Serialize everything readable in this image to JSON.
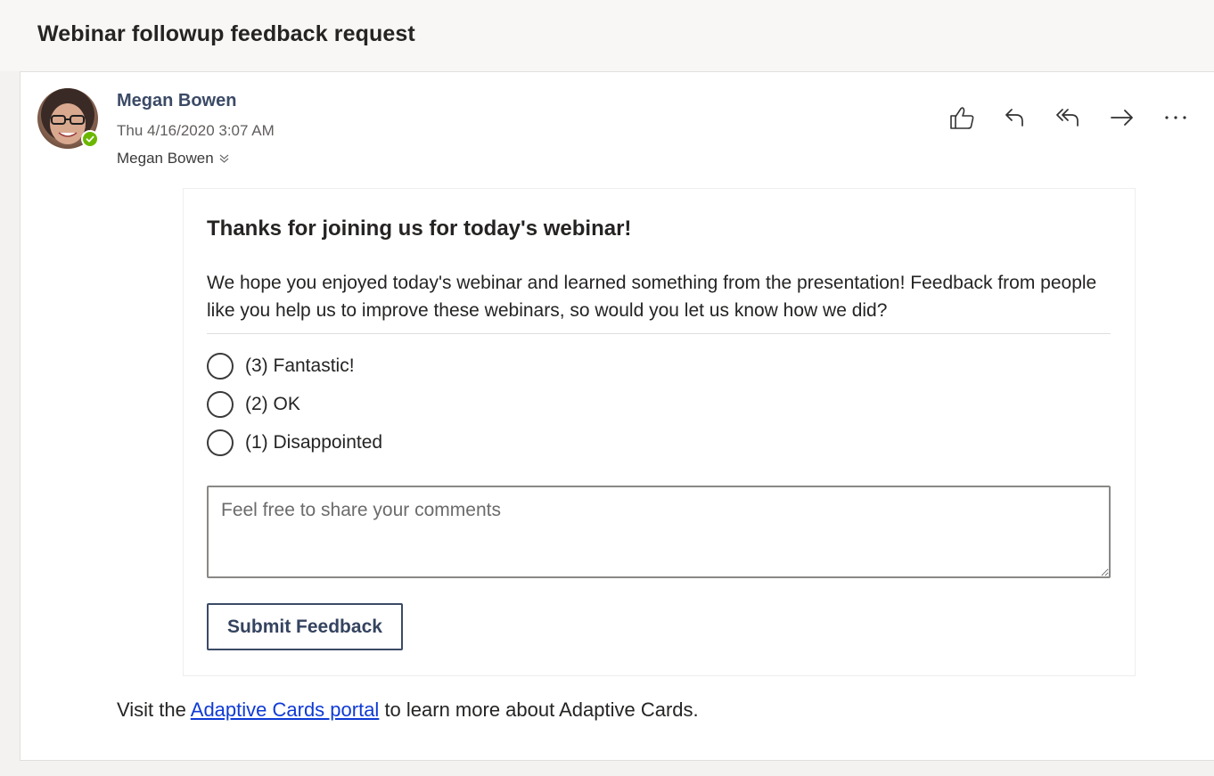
{
  "message": {
    "subject": "Webinar followup feedback request",
    "sender_name": "Megan Bowen",
    "sent_date": "Thu 4/16/2020 3:07 AM",
    "to": "Megan Bowen",
    "presence_color": "#6bb700",
    "actions": [
      {
        "label": "Like",
        "icon": "thumbs-up-icon"
      },
      {
        "label": "Reply",
        "icon": "reply-icon"
      },
      {
        "label": "Reply all",
        "icon": "reply-all-icon"
      },
      {
        "label": "Forward",
        "icon": "forward-icon"
      },
      {
        "label": "More actions",
        "icon": "more-icon"
      }
    ]
  },
  "card": {
    "title": "Thanks for joining us for today's webinar!",
    "body": "We hope you enjoyed today's webinar and learned something from the presentation! Feedback from people like you help us to improve these webinars, so would you let us know how we did?",
    "options": [
      {
        "label": "(3) Fantastic!"
      },
      {
        "label": "(2) OK"
      },
      {
        "label": "(1) Disappointed"
      }
    ],
    "comments_placeholder": "Feel free to share your comments",
    "comments_value": "",
    "submit_label": "Submit Feedback",
    "accent_color": "#3b4a66"
  },
  "footer": {
    "prefix": "Visit the ",
    "link_text": "Adaptive Cards portal",
    "suffix": " to learn more about Adaptive Cards.",
    "link_color": "#0e3ad6"
  }
}
